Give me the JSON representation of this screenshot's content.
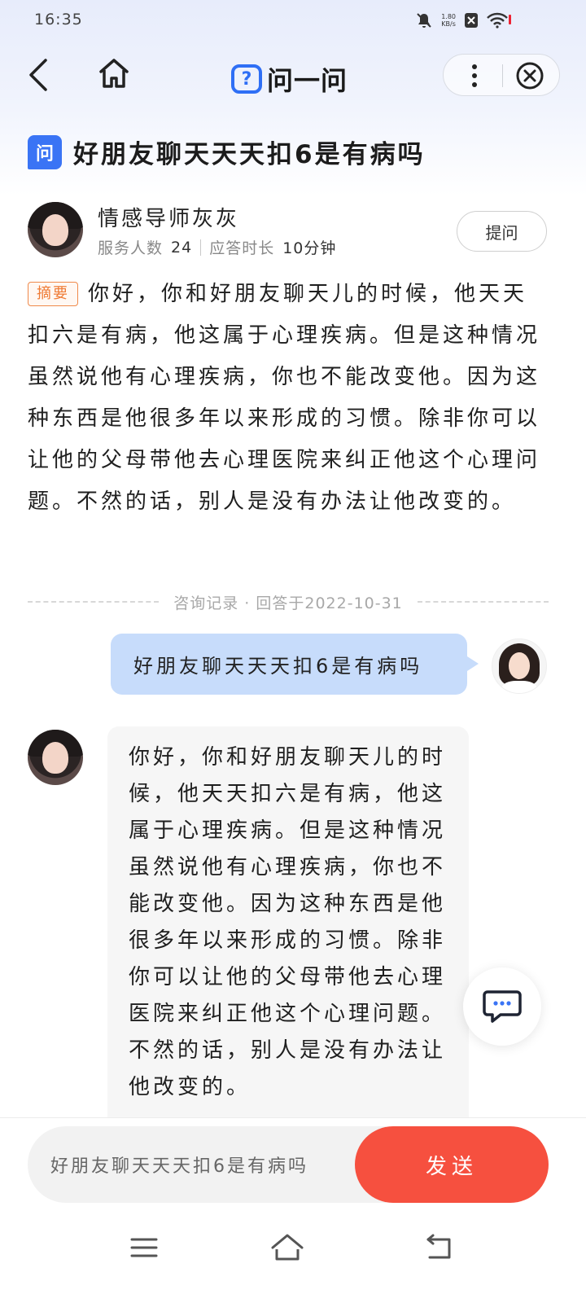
{
  "status_bar": {
    "time": "16:35",
    "net_speed_value": "1.80",
    "net_speed_unit": "KB/s"
  },
  "nav": {
    "brand": "问一问",
    "logo_mark": "?"
  },
  "question": {
    "icon_text": "问",
    "title": "好朋友聊天天天扣6是有病吗"
  },
  "expert": {
    "name": "情感导师灰灰",
    "served_label": "服务人数",
    "served_value": "24",
    "time_label": "应答时长",
    "time_value": "10分钟",
    "ask_button": "提问"
  },
  "summary": {
    "tag": "摘要",
    "text": "你好，你和好朋友聊天儿的时候，他天天扣六是有病，他这属于心理疾病。但是这种情况虽然说他有心理疾病，你也不能改变他。因为这种东西是他很多年以来形成的习惯。除非你可以让他的父母带他去心理医院来纠正他这个心理问题。不然的话，别人是没有办法让他改变的。"
  },
  "record": {
    "label": "咨询记录 · 回答于2022-10-31"
  },
  "chat": {
    "user_message": "好朋友聊天天天扣6是有病吗",
    "answer": "你好，你和好朋友聊天儿的时候，他天天扣六是有病，他这属于心理疾病。但是这种情况虽然说他有心理疾病，你也不能改变他。因为这种东西是他很多年以来形成的习惯。除非你可以让他的父母带他去心理医院来纠正他这个心理问题。不然的话，别人是没有办法让他改变的。"
  },
  "input": {
    "value": "好朋友聊天天天扣6是有病吗",
    "send_label": "发送"
  },
  "colors": {
    "accent_blue": "#2f6ff5",
    "send_red": "#f6503f",
    "summary_orange": "#ef7b35",
    "user_bubble": "#c7dcfb"
  }
}
